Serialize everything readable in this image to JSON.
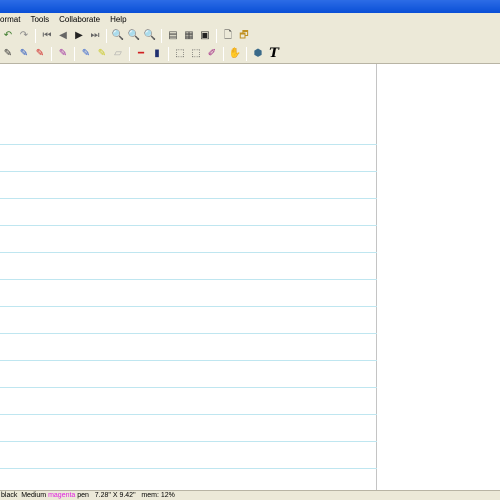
{
  "menu": [
    "ormat",
    "Tools",
    "Collaborate",
    "Help"
  ],
  "toolbar1": [
    {
      "icon": "undo-icon",
      "glyph": "↶",
      "color": "#3a7a2a"
    },
    {
      "icon": "redo-icon",
      "glyph": "↷",
      "color": "#8a8a8a"
    },
    {
      "sep": true
    },
    {
      "icon": "first-page-icon",
      "glyph": "⏮",
      "color": "#666666"
    },
    {
      "icon": "prev-page-icon",
      "glyph": "◀",
      "color": "#666666"
    },
    {
      "icon": "next-page-icon",
      "glyph": "▶",
      "color": "#222222"
    },
    {
      "icon": "last-page-icon",
      "glyph": "⏭",
      "color": "#666666"
    },
    {
      "sep": true
    },
    {
      "icon": "zoom-in-icon",
      "glyph": "🔍",
      "color": "#2a5ab0"
    },
    {
      "icon": "zoom-out-icon",
      "glyph": "🔍",
      "color": "#2a5ab0"
    },
    {
      "icon": "zoom-fit-icon",
      "glyph": "🔍",
      "color": "#2a5ab0"
    },
    {
      "sep": true
    },
    {
      "icon": "single-page-icon",
      "glyph": "▤",
      "color": "#444444"
    },
    {
      "icon": "multi-page-icon",
      "glyph": "▦",
      "color": "#444444"
    },
    {
      "icon": "fullscreen-icon",
      "glyph": "▣",
      "color": "#222222"
    },
    {
      "sep": true
    },
    {
      "icon": "new-page-icon",
      "glyph": "🗋",
      "color": "#444444"
    },
    {
      "icon": "insert-image-icon",
      "glyph": "🗗",
      "color": "#c09020"
    }
  ],
  "toolbar2": [
    {
      "icon": "pencil-icon",
      "glyph": "✎",
      "color": "#333333"
    },
    {
      "icon": "pen-blue-icon",
      "glyph": "✎",
      "color": "#2050c0"
    },
    {
      "icon": "pen-red-icon",
      "glyph": "✎",
      "color": "#d02020"
    },
    {
      "sep": true
    },
    {
      "icon": "pen-multicolor-icon",
      "glyph": "✎",
      "color": "#a030a0"
    },
    {
      "sep": true
    },
    {
      "icon": "highlighter-blue-icon",
      "glyph": "✎",
      "color": "#3060d0"
    },
    {
      "icon": "highlighter-yellow-icon",
      "glyph": "✎",
      "color": "#c8c820"
    },
    {
      "icon": "eraser-icon",
      "glyph": "▱",
      "color": "#aaaaaa"
    },
    {
      "sep": true
    },
    {
      "icon": "thin-line-icon",
      "glyph": "━",
      "color": "#d02020"
    },
    {
      "icon": "thick-line-icon",
      "glyph": "▮",
      "color": "#203070"
    },
    {
      "sep": true
    },
    {
      "icon": "lasso-select-icon",
      "glyph": "⬚",
      "color": "#555555"
    },
    {
      "icon": "rect-select-icon",
      "glyph": "⬚",
      "color": "#555555"
    },
    {
      "icon": "stylus-icon",
      "glyph": "✐",
      "color": "#a02080"
    },
    {
      "sep": true
    },
    {
      "icon": "hand-tool-icon",
      "glyph": "✋",
      "color": "#666666"
    },
    {
      "sep": true
    },
    {
      "icon": "shapes-icon",
      "glyph": "⬢",
      "color": "#3a6a8a"
    },
    {
      "icon": "text-tool-icon",
      "glyph": "T",
      "color": "#000000"
    }
  ],
  "statusbar": {
    "prefix": "black  Medium ",
    "color_name": "magenta",
    "suffix": " pen   7.28\" X 9.42\"   mem: 12%"
  },
  "colors": {
    "rule_line": "#bfe6f0",
    "chrome": "#ece9d8",
    "title_bar": "#0a4fd6"
  }
}
